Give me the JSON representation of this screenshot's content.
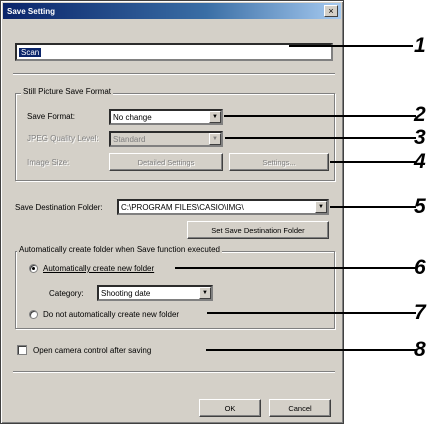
{
  "window": {
    "title": "Save Setting",
    "close_symbol": "×"
  },
  "name_field": {
    "value": "Scan"
  },
  "still_picture_group": {
    "label": "Still Picture Save Format",
    "file_format": {
      "label": "Save Format:",
      "value": "No change"
    },
    "quality": {
      "label": "JPEG Quality Level:",
      "value": "Standard"
    },
    "scale": {
      "label": "Image Size:",
      "value": ""
    },
    "detail_button": "Detailed Settings",
    "button_4": "Settings..."
  },
  "destination": {
    "label": "Save Destination Folder:",
    "value": "C:\\PROGRAM FILES\\CASIO\\IMG\\",
    "set_button": "Set Save Destination Folder"
  },
  "auto_folder_group": {
    "label": "Automatically create folder when Save function executed",
    "auto_create": {
      "label": "Automatically create new folder",
      "selected": true
    },
    "category": {
      "label": "Category:",
      "value": "Shooting date"
    },
    "no_auto": {
      "label": "Do not automatically create new folder",
      "selected": false
    }
  },
  "open_after_save": {
    "label": "Open camera control after saving",
    "checked": false
  },
  "footer": {
    "ok": "OK",
    "cancel": "Cancel"
  },
  "callouts": [
    "1",
    "2",
    "3",
    "4",
    "5",
    "6",
    "7",
    "8"
  ]
}
